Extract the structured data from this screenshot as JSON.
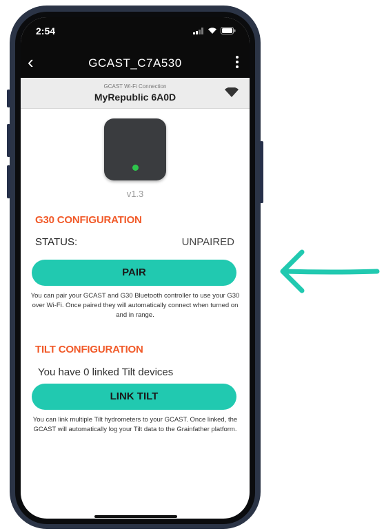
{
  "status_bar": {
    "time": "2:54"
  },
  "app_bar": {
    "title": "GCAST_C7A530"
  },
  "wifi": {
    "caption": "GCAST Wi-Fi Connection",
    "network": "MyRepublic 6A0D"
  },
  "device": {
    "version": "v1.3"
  },
  "g30": {
    "heading": "G30 CONFIGURATION",
    "status_label": "STATUS:",
    "status_value": "UNPAIRED",
    "pair_label": "PAIR",
    "help": "You can pair your GCAST and G30 Bluetooth controller to use your G30 over Wi-Fi. Once paired they will automatically connect when turned on and in range."
  },
  "tilt": {
    "heading": "TILT CONFIGURATION",
    "count_text": "You have 0 linked Tilt devices",
    "link_label": "LINK TILT",
    "help": "You can link multiple Tilt hydrometers to your GCAST. Once linked, the GCAST will automatically log your Tilt data to the Grainfather platform."
  },
  "colors": {
    "accent": "#21c9b0",
    "heading": "#f15a29",
    "led": "#2ec54c",
    "phone_frame": "#2b3446"
  },
  "icons": [
    "back-arrow-icon",
    "more-vert-icon",
    "wifi-icon",
    "signal-icon",
    "battery-icon",
    "pointer-arrow-icon"
  ]
}
